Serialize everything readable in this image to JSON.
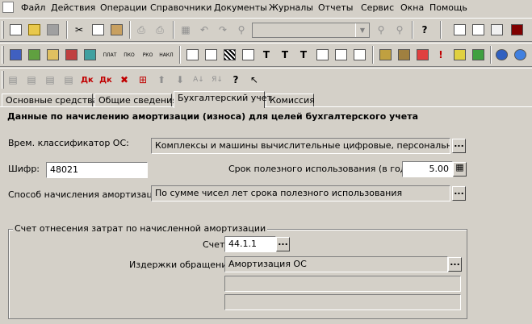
{
  "menu": {
    "items": [
      "Файл",
      "Действия",
      "Операции",
      "Справочники",
      "Документы",
      "Журналы",
      "Отчеты",
      "Сервис",
      "Окна",
      "Помощь"
    ]
  },
  "toolbar3": {
    "icon_labels": [
      "ПЛАТ",
      "ПКО",
      "РКО",
      "НАКЛ"
    ]
  },
  "tabs": [
    "Основные средства",
    "Общие сведения",
    "Бухгалтерский учет",
    "Комиссия"
  ],
  "active_tab": "Бухгалтерский учет",
  "form": {
    "section_title": "Данные по начислению амортизации (износа) для целей бухгалтерского учета",
    "classifier_label": "Врем. классификатор ОС:",
    "classifier_value": "Комплексы и машины вычислительные цифровые, персональные ЭВМ",
    "code_label": "Шифр:",
    "code_value": "48021",
    "useful_life_label": "Срок полезного использования (в годах):",
    "useful_life_value": "5.00",
    "method_label": "Способ начисления амортизации:",
    "method_value": "По сумме чисел лет срока полезного использования",
    "group_title": "Счет отнесения затрат по начисленной амортизации",
    "account_label": "Счет",
    "account_value": "44.1.1",
    "costs_label": "Издержки обращения",
    "costs_value": "Амортизация ОС",
    "extra1_value": "",
    "extra2_value": ""
  },
  "ellipsis": "..."
}
